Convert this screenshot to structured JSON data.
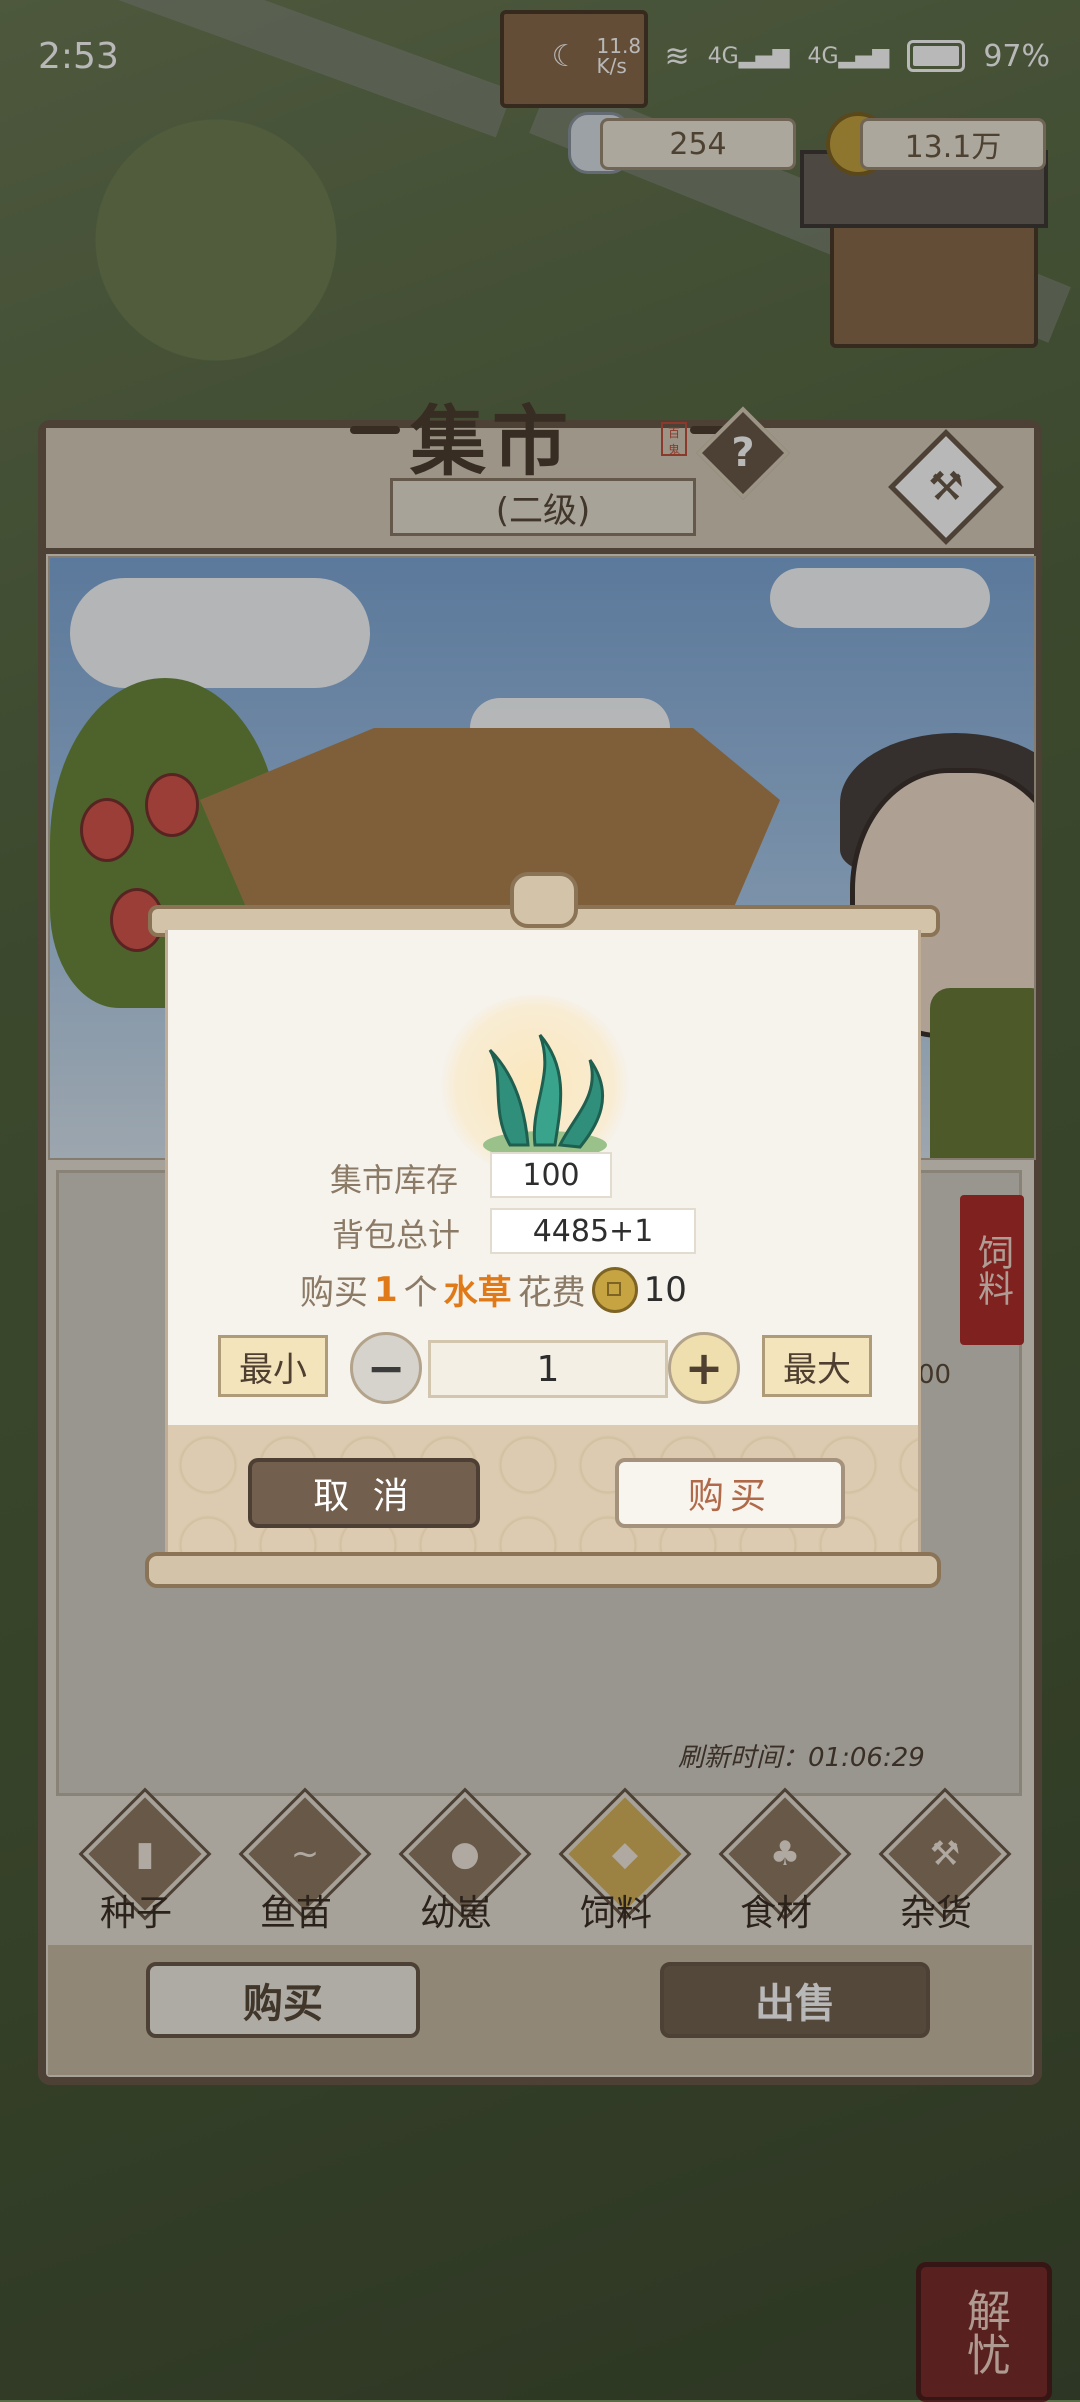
{
  "status_bar": {
    "time": "2:53",
    "speed": "11.8 K/s",
    "network": "4G",
    "battery": "97%"
  },
  "currency": {
    "silver": "254",
    "coins": "13.1万"
  },
  "panel": {
    "title": "集市",
    "seal": "百鬼",
    "level": "(二级)",
    "feed_tag": "饲料",
    "side_price": "00"
  },
  "refresh": {
    "label": "刷新时间：",
    "value": "01:06:29"
  },
  "categories": [
    {
      "label": "种子",
      "icon": "seed-bag-icon"
    },
    {
      "label": "鱼苗",
      "icon": "fish-icon"
    },
    {
      "label": "幼崽",
      "icon": "pig-icon"
    },
    {
      "label": "饲料",
      "icon": "feed-sack-icon"
    },
    {
      "label": "食材",
      "icon": "teapot-icon"
    },
    {
      "label": "杂货",
      "icon": "axe-icon"
    }
  ],
  "footer": {
    "buy": "购买",
    "sell": "出售"
  },
  "modal": {
    "stock_label": "集市库存",
    "stock_value": "100",
    "bag_label": "背包总计",
    "bag_value": "4485+1",
    "cost_pre": "购买",
    "cost_qty": "1",
    "cost_unit": "个",
    "cost_item": "水草",
    "cost_mid": "花费",
    "cost_value": "10",
    "min_label": "最小",
    "max_label": "最大",
    "minus": "−",
    "plus": "+",
    "quantity": "1",
    "cancel": "取 消",
    "confirm": "购买"
  },
  "badge": "解忧"
}
